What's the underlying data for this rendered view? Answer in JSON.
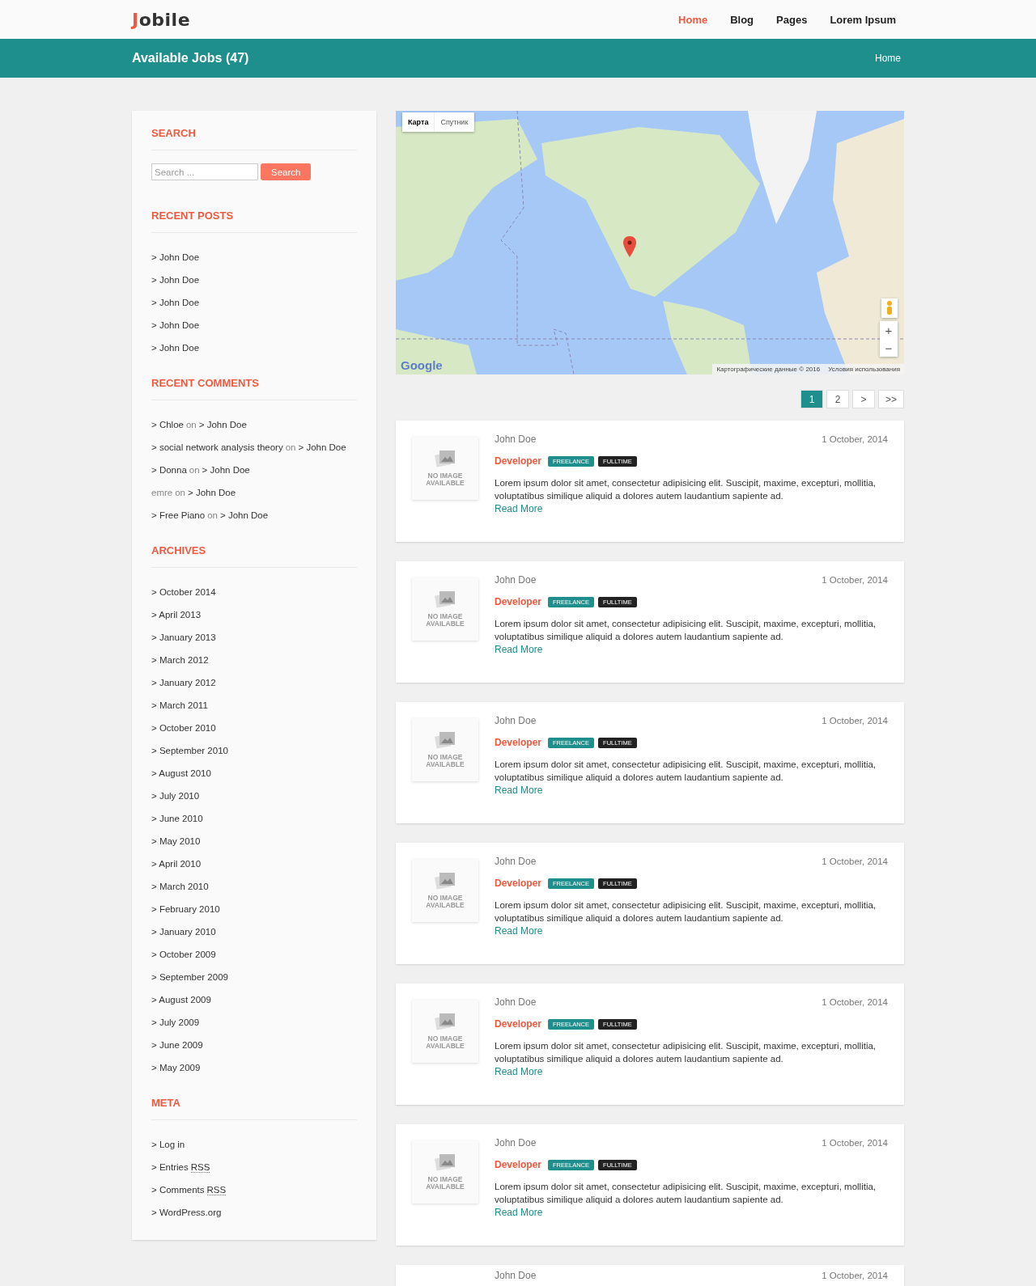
{
  "header": {
    "logo": {
      "initial": "J",
      "rest": "obile"
    },
    "nav": [
      {
        "label": "Home",
        "selected": true
      },
      {
        "label": "Blog",
        "selected": false
      },
      {
        "label": "Pages",
        "selected": false
      },
      {
        "label": "Lorem Ipsum",
        "selected": false
      }
    ]
  },
  "banner": {
    "title": "Available Jobs (47)",
    "breadcrumb": "Home"
  },
  "sidebar": {
    "search": {
      "title": "SEARCH",
      "placeholder": "Search ...",
      "button": "Search"
    },
    "recent_posts": {
      "title": "RECENT POSTS",
      "items": [
        "> John Doe",
        "> John Doe",
        "> John Doe",
        "> John Doe",
        "> John Doe"
      ]
    },
    "recent_comments": {
      "title": "RECENT COMMENTS",
      "items": [
        {
          "kind": "link",
          "author": "> Chloe",
          "on": "on",
          "post": "> John Doe"
        },
        {
          "kind": "link",
          "author": "> social network analysis theory",
          "on": "on",
          "post": "> John Doe"
        },
        {
          "kind": "link",
          "author": "> Donna",
          "on": "on",
          "post": "> John Doe"
        },
        {
          "kind": "plain",
          "author": "emre",
          "on": "on",
          "post": "> John Doe"
        },
        {
          "kind": "link",
          "author": "> Free Piano",
          "on": "on",
          "post": "> John Doe"
        }
      ]
    },
    "archives": {
      "title": "ARCHIVES",
      "items": [
        "> October 2014",
        "> April 2013",
        "> January 2013",
        "> March 2012",
        "> January 2012",
        "> March 2011",
        "> October 2010",
        "> September 2010",
        "> August 2010",
        "> July 2010",
        "> June 2010",
        "> May 2010",
        "> April 2010",
        "> March 2010",
        "> February 2010",
        "> January 2010",
        "> October 2009",
        "> September 2009",
        "> August 2009",
        "> July 2009",
        "> June 2009",
        "> May 2009"
      ]
    },
    "meta": {
      "title": "META",
      "items": [
        {
          "text": "> Log in"
        },
        {
          "text": "> Entries",
          "abbr": "RSS"
        },
        {
          "text": "> Comments",
          "abbr": "RSS"
        },
        {
          "text": "> WordPress.org"
        }
      ]
    }
  },
  "map": {
    "map_types": [
      {
        "label": "Карта",
        "selected": true
      },
      {
        "label": "Спутник",
        "selected": false
      }
    ],
    "logo": "Google",
    "attribution": "Картографические данные © 2016",
    "terms": "Условия использования",
    "zoom_in": "+",
    "zoom_out": "−"
  },
  "pagination": [
    {
      "label": "1",
      "selected": true
    },
    {
      "label": "2",
      "selected": false
    },
    {
      "label": ">",
      "selected": false
    },
    {
      "label": ">>",
      "selected": false
    }
  ],
  "jobs": [
    {
      "kind": "full",
      "image": [
        "NO IMAGE",
        "AVAILABLE"
      ],
      "author": "John Doe",
      "date": "1 October, 2014",
      "title": "Developer",
      "tags": [
        {
          "label": "FREELANCE",
          "color": "#1e8f8c"
        },
        {
          "label": "FULLTIME",
          "color": "#222222"
        }
      ],
      "description": "Lorem ipsum dolor sit amet, consectetur adipisicing elit. Suscipit, maxime, excepturi, mollitia, voluptatibus similique aliquid a dolores autem laudantium sapiente ad.",
      "link": "Read More"
    },
    {
      "kind": "full",
      "image": [
        "NO IMAGE",
        "AVAILABLE"
      ],
      "author": "John Doe",
      "date": "1 October, 2014",
      "title": "Developer",
      "tags": [
        {
          "label": "FREELANCE",
          "color": "#1e8f8c"
        },
        {
          "label": "FULLTIME",
          "color": "#222222"
        }
      ],
      "description": "Lorem ipsum dolor sit amet, consectetur adipisicing elit. Suscipit, maxime, excepturi, mollitia, voluptatibus similique aliquid a dolores autem laudantium sapiente ad.",
      "link": "Read More"
    },
    {
      "kind": "full",
      "image": [
        "NO IMAGE",
        "AVAILABLE"
      ],
      "author": "John Doe",
      "date": "1 October, 2014",
      "title": "Developer",
      "tags": [
        {
          "label": "FREELANCE",
          "color": "#1e8f8c"
        },
        {
          "label": "FULLTIME",
          "color": "#222222"
        }
      ],
      "description": "Lorem ipsum dolor sit amet, consectetur adipisicing elit. Suscipit, maxime, excepturi, mollitia, voluptatibus similique aliquid a dolores autem laudantium sapiente ad.",
      "link": "Read More"
    },
    {
      "kind": "full",
      "image": [
        "NO IMAGE",
        "AVAILABLE"
      ],
      "author": "John Doe",
      "date": "1 October, 2014",
      "title": "Developer",
      "tags": [
        {
          "label": "FREELANCE",
          "color": "#1e8f8c"
        },
        {
          "label": "FULLTIME",
          "color": "#222222"
        }
      ],
      "description": "Lorem ipsum dolor sit amet, consectetur adipisicing elit. Suscipit, maxime, excepturi, mollitia, voluptatibus similique aliquid a dolores autem laudantium sapiente ad.",
      "link": "Read More"
    },
    {
      "kind": "full",
      "image": [
        "NO IMAGE",
        "AVAILABLE"
      ],
      "author": "John Doe",
      "date": "1 October, 2014",
      "title": "Developer",
      "tags": [
        {
          "label": "FREELANCE",
          "color": "#1e8f8c"
        },
        {
          "label": "FULLTIME",
          "color": "#222222"
        }
      ],
      "description": "Lorem ipsum dolor sit amet, consectetur adipisicing elit. Suscipit, maxime, excepturi, mollitia, voluptatibus similique aliquid a dolores autem laudantium sapiente ad.",
      "link": "Read More"
    },
    {
      "kind": "full",
      "image": [
        "NO IMAGE",
        "AVAILABLE"
      ],
      "author": "John Doe",
      "date": "1 October, 2014",
      "title": "Developer",
      "tags": [
        {
          "label": "FREELANCE",
          "color": "#1e8f8c"
        },
        {
          "label": "FULLTIME",
          "color": "#222222"
        }
      ],
      "description": "Lorem ipsum dolor sit amet, consectetur adipisicing elit. Suscipit, maxime, excepturi, mollitia, voluptatibus similique aliquid a dolores autem laudantium sapiente ad.",
      "link": "Read More"
    },
    {
      "kind": "partial",
      "author": "John Doe",
      "date": "1 October, 2014"
    }
  ]
}
